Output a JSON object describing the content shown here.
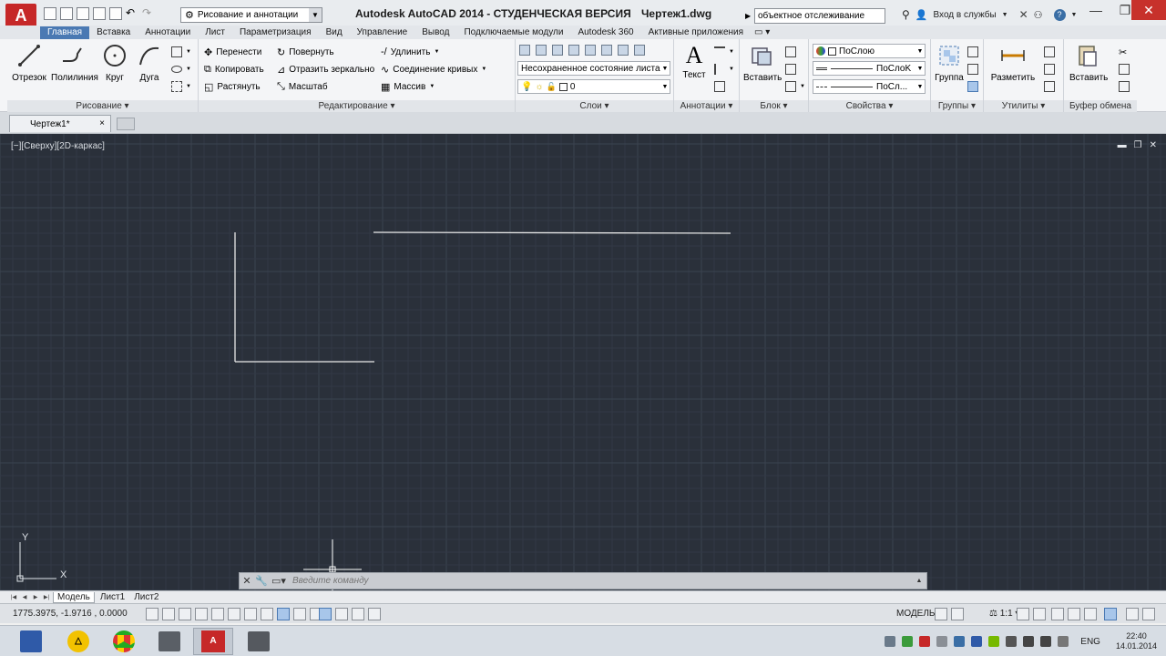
{
  "titlebar": {
    "app_logo": "A",
    "workspace": "Рисование и аннотации",
    "app_title": "Autodesk AutoCAD 2014 - СТУДЕНЧЕСКАЯ ВЕРСИЯ",
    "doc_title": "Чертеж1.dwg",
    "search_value": "объектное отслеживание",
    "login": "Вход в службы",
    "help": "?"
  },
  "tabs": [
    "Главная",
    "Вставка",
    "Аннотации",
    "Лист",
    "Параметризация",
    "Вид",
    "Управление",
    "Вывод",
    "Подключаемые модули",
    "Autodesk 360",
    "Активные приложения"
  ],
  "ribbon": {
    "draw": {
      "title": "Рисование",
      "line": "Отрезок",
      "polyline": "Полилиния",
      "circle": "Круг",
      "arc": "Дуга"
    },
    "modify": {
      "title": "Редактирование",
      "move": "Перенести",
      "rotate": "Повернуть",
      "trim": "Удлинить",
      "copy": "Копировать",
      "mirror": "Отразить зеркально",
      "join": "Соединение кривых",
      "stretch": "Растянуть",
      "scale": "Масштаб",
      "array": "Массив"
    },
    "layers": {
      "title": "Слои",
      "state": "Несохраненное состояние листа",
      "current": "0"
    },
    "annotation": {
      "title": "Аннотации",
      "text": "Текст"
    },
    "block": {
      "title": "Блок",
      "insert": "Вставить"
    },
    "properties": {
      "title": "Свойства",
      "color": "ПоСлою",
      "linetype": "ПоСлоK",
      "lineweight": "ПоСл..."
    },
    "groups": {
      "title": "Группы",
      "group": "Группа"
    },
    "utilities": {
      "title": "Утилиты",
      "measure": "Разметить"
    },
    "clipboard": {
      "title": "Буфер обмена",
      "paste": "Вставить"
    }
  },
  "filetab": {
    "label": "Чертеж1*",
    "close": "×"
  },
  "viewport": {
    "label": "[−][Сверху][2D-каркас]"
  },
  "commandline": {
    "placeholder": "Введите команду"
  },
  "layout_tabs": [
    "Модель",
    "Лист1",
    "Лист2"
  ],
  "status": {
    "coords": "1775.3975, -1.9716 , 0.0000",
    "model": "МОДЕЛЬ",
    "scale": "1:1"
  },
  "taskbar": {
    "lang": "ENG",
    "time": "22:40",
    "date": "14.01.2014"
  },
  "colors": {
    "canvas_bg": "#2a303a",
    "grid_minor": "#323945",
    "grid_major": "#3b4350",
    "accent": "#4a79b3",
    "logo_red": "#c62828"
  }
}
